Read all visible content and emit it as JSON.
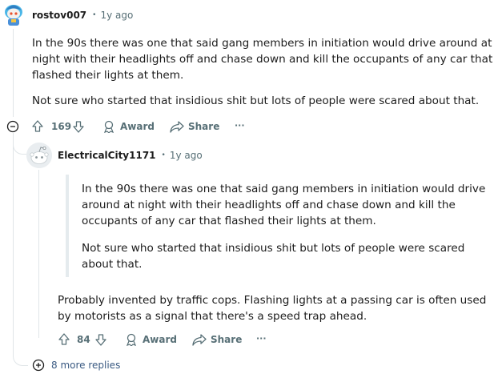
{
  "comment": {
    "username": "rostov007",
    "dot": "•",
    "time": "1y ago",
    "paragraphs": [
      "In the 90s there was one that said gang members in initiation would drive around at night with their headlights off and chase down and kill the occupants of any car that flashed their lights at them.",
      "Not sure who started that insidious shit but lots of people were scared about that."
    ],
    "votes": "169",
    "award_label": "Award",
    "share_label": "Share",
    "more_label": "···"
  },
  "reply": {
    "username": "ElectricalCity1171",
    "dot": "•",
    "time": "1y ago",
    "quote_paragraphs": [
      "In the 90s there was one that said gang members in initiation would drive around at night with their headlights off and chase down and kill the occupants of any car that flashed their lights at them.",
      "Not sure who started that insidious shit but lots of people were scared about that."
    ],
    "paragraph": "Probably invented by traffic cops. Flashing lights at a passing car is often used by motorists as a signal that there's a speed trap ahead.",
    "votes": "84",
    "award_label": "Award",
    "share_label": "Share",
    "more_label": "···"
  },
  "more_replies": "8 more replies",
  "colors": {
    "text": "#1c1c1c",
    "meta": "#576f76",
    "thread_line": "#e0e5e8",
    "link": "#3a5a82"
  }
}
